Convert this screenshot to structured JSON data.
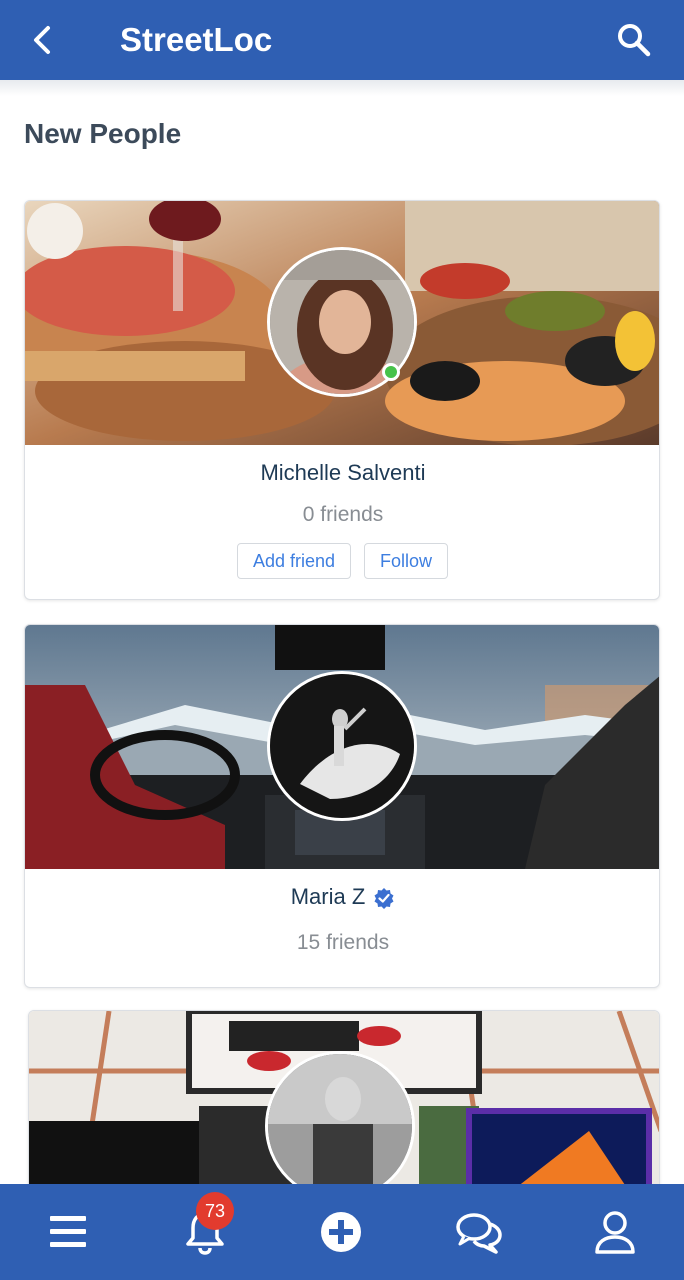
{
  "header": {
    "title": "StreetLoc",
    "back_icon": "chevron-left-icon",
    "search_icon": "search-icon"
  },
  "section": {
    "title": "New People"
  },
  "people": [
    {
      "name": "Michelle Salventi",
      "friends": "0 friends",
      "online": true,
      "verified": false,
      "add_friend_label": "Add friend",
      "follow_label": "Follow"
    },
    {
      "name": "Maria Z",
      "friends": "15 friends",
      "online": false,
      "verified": true
    }
  ],
  "bottom_nav": {
    "items": [
      "menu-icon",
      "bell-icon",
      "plus-circle-icon",
      "chat-icon",
      "profile-icon"
    ],
    "notification_count": "73"
  },
  "colors": {
    "primary": "#2f5fb3",
    "badge": "#e23b2e",
    "online": "#47c24a",
    "link": "#3d7ee0"
  }
}
